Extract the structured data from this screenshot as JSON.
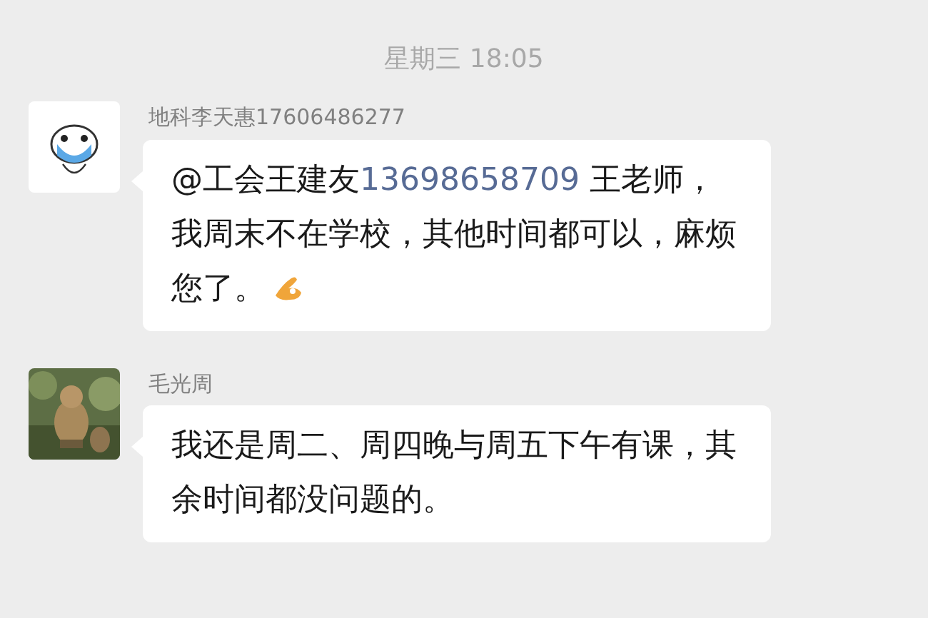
{
  "timestamp": "星期三 18:05",
  "messages": [
    {
      "sender": "地科李天惠17606486277",
      "avatar": {
        "kind": "cartoon"
      },
      "segments": [
        {
          "kind": "plain",
          "text": "@工会王建友"
        },
        {
          "kind": "phone",
          "text": "13698658709"
        },
        {
          "kind": "plain",
          "text": " 王老师，我周末不在学校，其他时间都可以，麻烦您了。"
        }
      ],
      "emoji": true
    },
    {
      "sender": "毛光周",
      "avatar": {
        "kind": "picture"
      },
      "segments": [
        {
          "kind": "plain",
          "text": "我还是周二、周四晚与周五下午有课，其余时间都没问题的。"
        }
      ],
      "emoji": false
    }
  ]
}
